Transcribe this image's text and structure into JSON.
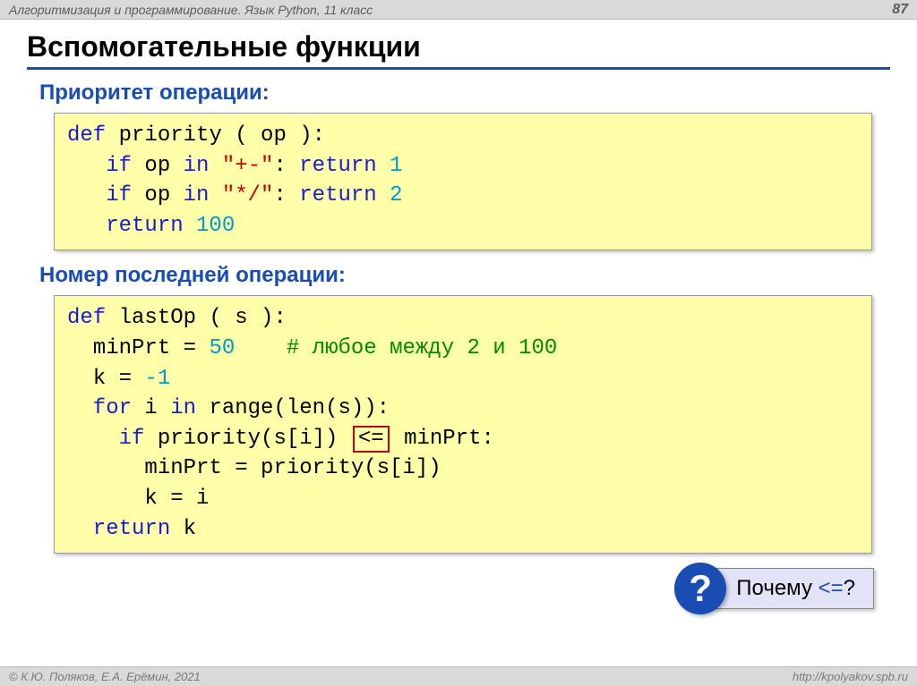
{
  "header": {
    "course": "Алгоритмизация и программирование. Язык Python, 11 класс",
    "page": "87"
  },
  "title": "Вспомогательные функции",
  "section1": "Приоритет операции:",
  "code1": {
    "l1_def": "def",
    "l1_name": " priority",
    "l1_rest": " ( op ):",
    "l2_if": "   if",
    "l2_op": " op ",
    "l2_in": "in",
    "l2_str": " \"+-\"",
    "l2_colon": ": ",
    "l2_ret": "return",
    "l2_num": " 1",
    "l3_if": "   if",
    "l3_op": " op ",
    "l3_in": "in",
    "l3_str": " \"*/\"",
    "l3_colon": ": ",
    "l3_ret": "return",
    "l3_num": " 2",
    "l4_ret": "   return",
    "l4_num": " 100"
  },
  "section2": "Номер последней операции:",
  "code2": {
    "l1_def": "def",
    "l1_name": " lastOp",
    "l1_rest": " ( s ):",
    "l2a": "  minPrt = ",
    "l2b": "50",
    "l2c": "    ",
    "l2d": "# любое между 2 и 100",
    "l3a": "  k = ",
    "l3b": "-1",
    "l4_for": "  for",
    "l4_mid": " i ",
    "l4_in": "in",
    "l4_rest": " range(len(s)):",
    "l5_if": "    if",
    "l5_mid": " priority(s[i]) ",
    "l5_op": "<=",
    "l5_end": " minPrt:",
    "l6": "      minPrt = priority(s[i])",
    "l7": "      k = i",
    "l8_ret": "  return",
    "l8_end": " k"
  },
  "callout": {
    "q": "?",
    "text_a": " Почему ",
    "text_op": "<=",
    "text_b": "?"
  },
  "footer": {
    "left": "© К.Ю. Поляков, Е.А. Ерёмин, 2021",
    "right": "http://kpolyakov.spb.ru"
  }
}
